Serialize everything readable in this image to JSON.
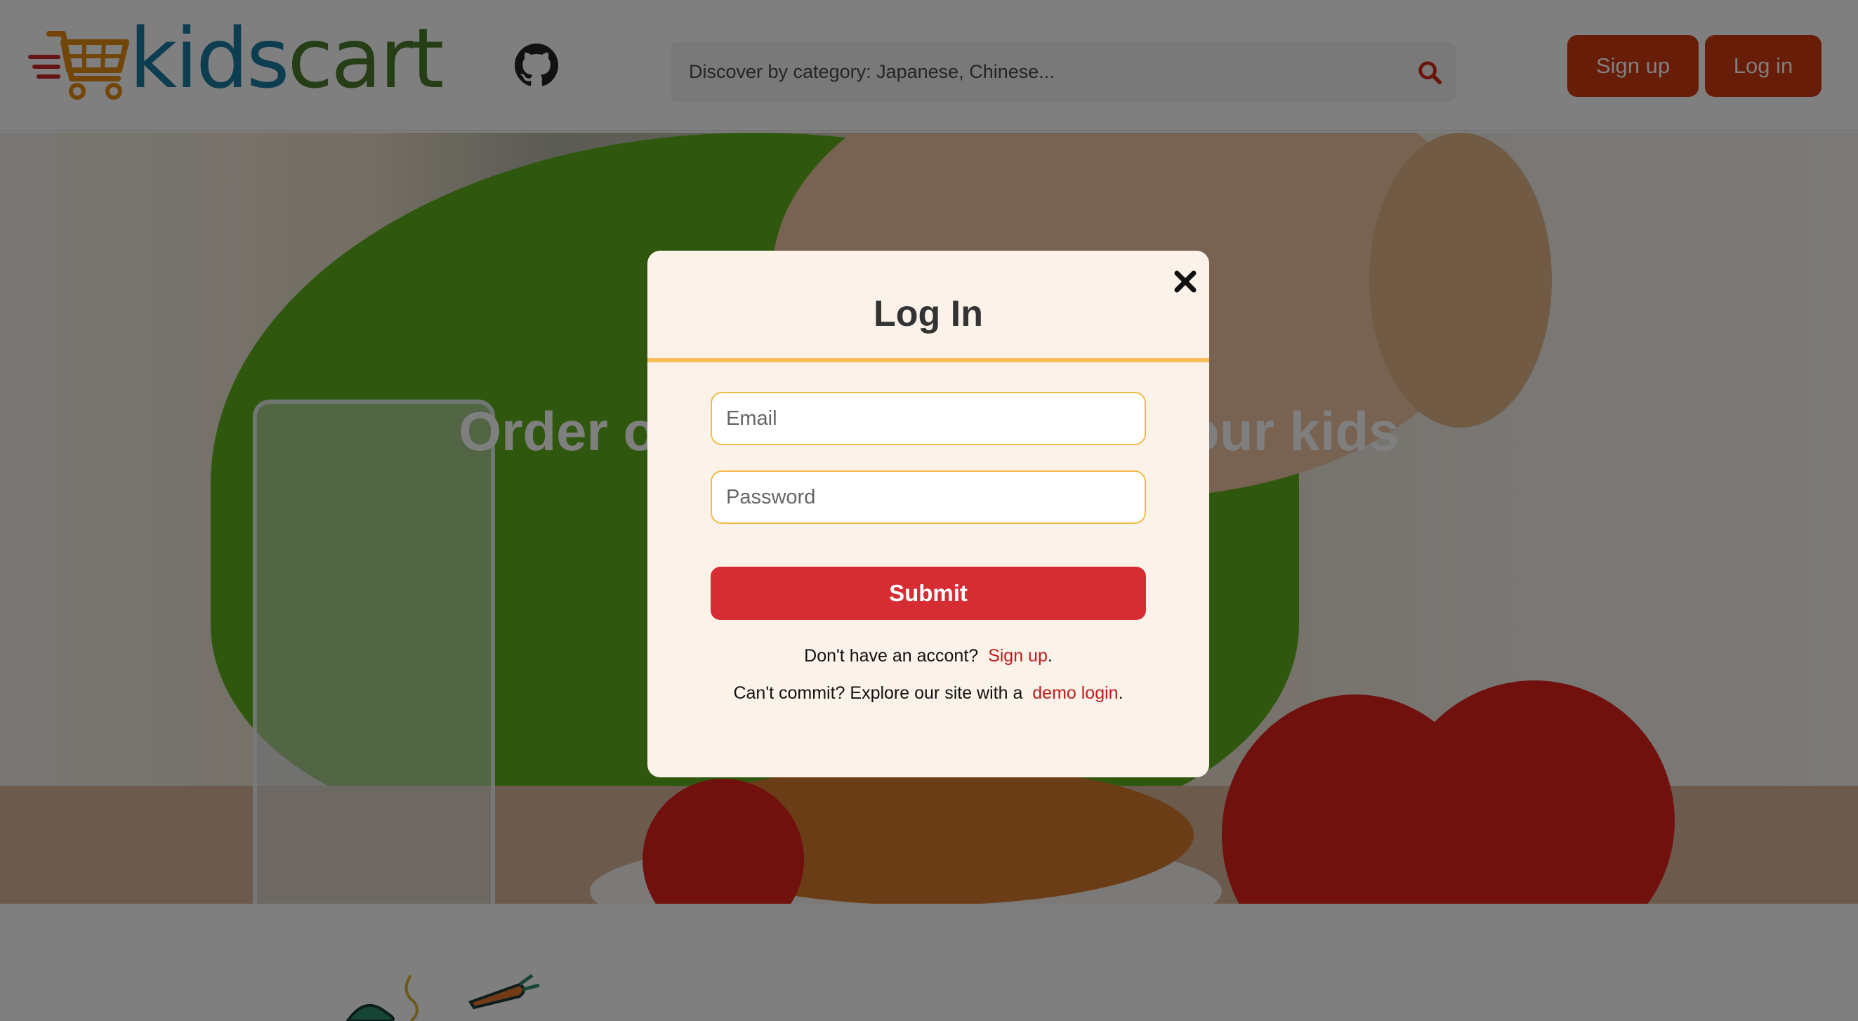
{
  "header": {
    "logo": {
      "text_part1": "kids",
      "text_part2": "cart",
      "color1": "#1b7aa0",
      "color2": "#4b7c2a",
      "cart_color": "#e58a12",
      "lines_color": "#c8282a"
    },
    "github_icon": "github-icon",
    "search": {
      "placeholder": "Discover by category: Japanese, Chinese...",
      "icon": "search-icon",
      "icon_color": "#d62a14"
    },
    "signup_label": "Sign up",
    "login_label": "Log in",
    "button_color": "#cf3a10"
  },
  "hero": {
    "headline": "Order our healthy food for your kids"
  },
  "modal": {
    "title": "Log In",
    "close_icon": "close-icon",
    "email_placeholder": "Email",
    "password_placeholder": "Password",
    "submit_label": "Submit",
    "no_account_text": "Don't have an accont?",
    "signup_link": "Sign up",
    "period": ".",
    "demo_text": "Can't commit? Explore our site with a",
    "demo_link": "demo login",
    "submit_color": "#d62d34",
    "accent_color": "#f7bd57"
  }
}
